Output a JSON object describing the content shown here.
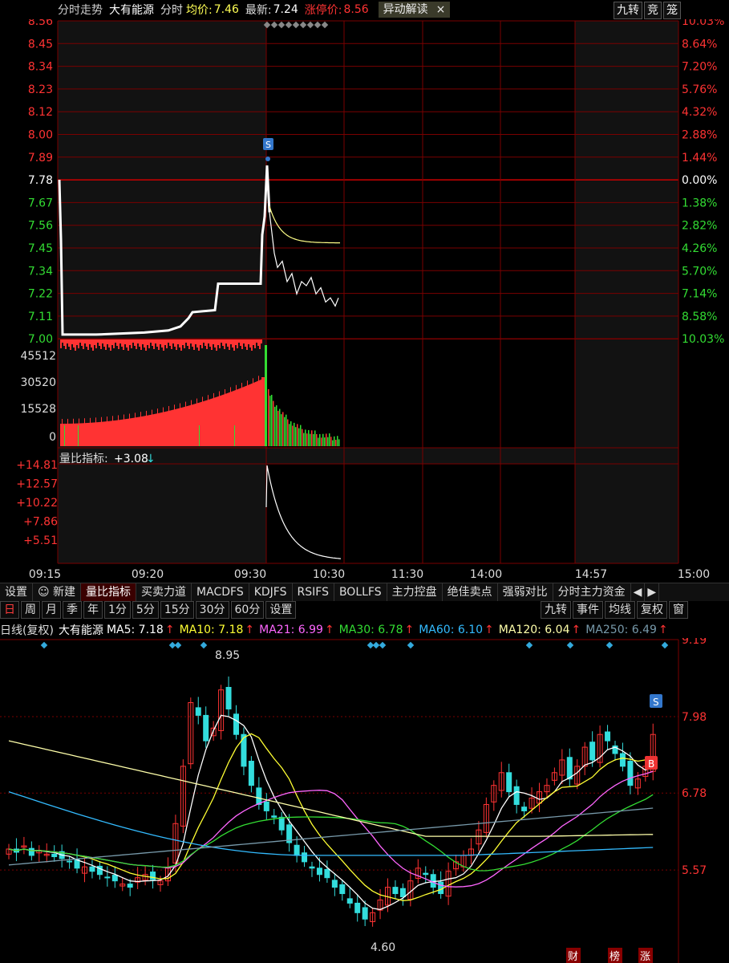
{
  "header": {
    "mode": "分时走势",
    "stock": "大有能源",
    "type": "分时",
    "avg_label": "均价:",
    "avg": "7.46",
    "latest_label": "最新:",
    "latest": "7.24",
    "limit_label": "涨停价:",
    "limit": "8.56",
    "anomaly": "异动解读",
    "close": "×",
    "btn_jiuzhuan": "九转",
    "btn_jing": "竞",
    "btn_long": "笼"
  },
  "intraday": {
    "price_labels": [
      "8.56",
      "8.45",
      "8.34",
      "8.23",
      "8.12",
      "8.00",
      "7.89",
      "7.78",
      "7.67",
      "7.56",
      "7.45",
      "7.34",
      "7.22",
      "7.11",
      "7.00"
    ],
    "pct_labels": [
      "10.03%",
      "8.64%",
      "7.20%",
      "5.76%",
      "4.32%",
      "2.88%",
      "1.44%",
      "0.00%",
      "1.38%",
      "2.82%",
      "4.26%",
      "5.70%",
      "7.14%",
      "8.58%",
      "10.03%"
    ],
    "volume_labels": [
      "45512",
      "30520",
      "15528",
      "0"
    ],
    "time_labels": [
      "09:15",
      "09:20",
      "09:30",
      "10:30",
      "11:30",
      "14:00",
      "14:57",
      "15:00"
    ],
    "s_marker": "S"
  },
  "liangbi": {
    "title": "量比指标:",
    "value": "+3.08",
    "arrow": "↓",
    "labels": [
      "+14.81",
      "+12.57",
      "+10.22",
      "+7.86",
      "+5.51"
    ]
  },
  "tabs": [
    "设置",
    "新建",
    "量比指标",
    "买卖力道",
    "MACDFS",
    "KDJFS",
    "RSIFS",
    "BOLLFS",
    "主力控盘",
    "绝佳卖点",
    "强弱对比",
    "分时主力资金"
  ],
  "tab_icons": {
    "new": "robot-icon",
    "left": "◀",
    "right": "▶"
  },
  "periods": [
    "日",
    "周",
    "月",
    "季",
    "年",
    "1分",
    "5分",
    "15分",
    "30分",
    "60分",
    "设置"
  ],
  "right_buttons": [
    "九转",
    "事件",
    "均线",
    "复权",
    "窗"
  ],
  "ma": {
    "prefix": "日线(复权)",
    "stock": "大有能源",
    "items": [
      {
        "label": "MA5: 7.18",
        "color": "#ffffff"
      },
      {
        "label": "MA10: 7.18",
        "color": "#ffff33"
      },
      {
        "label": "MA21: 6.99",
        "color": "#ff66ff"
      },
      {
        "label": "MA30: 6.78",
        "color": "#33dd33"
      },
      {
        "label": "MA60: 6.10",
        "color": "#33bbff"
      },
      {
        "label": "MA120: 6.04",
        "color": "#ffffaa"
      },
      {
        "label": "MA250: 6.49",
        "color": "#7799aa"
      }
    ],
    "arrow": "↑"
  },
  "kline": {
    "price_labels": [
      "9.19",
      "7.98",
      "6.78",
      "5.57"
    ],
    "high_label": "8.95",
    "low_label": "4.60",
    "markers": [
      "S",
      "B"
    ],
    "bottom_tags": [
      "财",
      "榜",
      "涨"
    ]
  },
  "colors": {
    "up": "#ff3333",
    "down": "#33dddd",
    "green": "#33dd33",
    "grid": "#7a0000"
  }
}
